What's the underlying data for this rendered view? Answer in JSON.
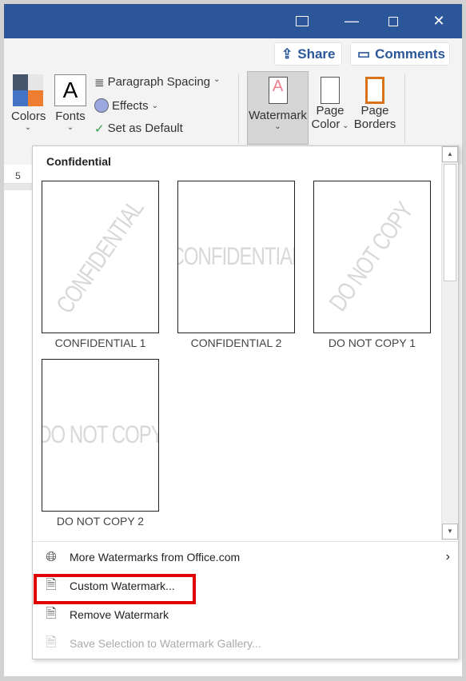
{
  "titlebar": {
    "accent": "#2b579a"
  },
  "header": {
    "share_label": "Share",
    "comments_label": "Comments"
  },
  "ribbon": {
    "colors_label": "Colors",
    "fonts_label": "Fonts",
    "fonts_glyph": "A",
    "paragraph_spacing_label": "Paragraph Spacing",
    "effects_label": "Effects",
    "set_default_label": "Set as Default",
    "watermark_label": "Watermark",
    "page_color_label_1": "Page",
    "page_color_label_2": "Color",
    "page_borders_label_1": "Page",
    "page_borders_label_2": "Borders"
  },
  "ruler": {
    "number": "5"
  },
  "gallery": {
    "section_title": "Confidential",
    "items": [
      {
        "label": "CONFIDENTIAL 1",
        "text": "CONFIDENTIAL",
        "diagonal": true
      },
      {
        "label": "CONFIDENTIAL 2",
        "text": "CONFIDENTIAL",
        "diagonal": false
      },
      {
        "label": "DO NOT COPY 1",
        "text": "DO NOT COPY",
        "diagonal": true
      },
      {
        "label": "DO NOT COPY 2",
        "text": "DO NOT COPY",
        "diagonal": false
      }
    ]
  },
  "menu": {
    "items": [
      {
        "label": "More Watermarks from Office.com",
        "icon": "globe-icon",
        "enabled": true,
        "submenu": true
      },
      {
        "label": "Custom Watermark...",
        "icon": "custom-watermark-icon",
        "enabled": true,
        "highlighted": true,
        "highlight_color": "#e00000"
      },
      {
        "label": "Remove Watermark",
        "icon": "remove-watermark-icon",
        "enabled": true
      },
      {
        "label": "Save Selection to Watermark Gallery...",
        "icon": "save-selection-icon",
        "enabled": false
      }
    ]
  }
}
